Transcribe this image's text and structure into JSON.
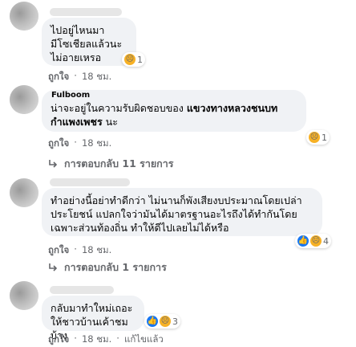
{
  "comments": [
    {
      "text_lines": [
        "ไปอยู่ไหนมา",
        "มีโซเชียลแล้วนะ",
        "ไม่อายเหรอ"
      ],
      "reaction_count": "1",
      "reaction_icons": [
        "sad-icon"
      ],
      "like_label": "ถูกใจ",
      "time": "18 ชม."
    },
    {
      "author": "Fulboom Hippiman",
      "text_prefix": "น่าจะอยู่ในความรับผิดชอบของ ",
      "text_bold": "แขวงทางหลวงชนบทกำแพงเพชร",
      "text_suffix": " นะ",
      "reaction_count": "1",
      "reaction_icons": [
        "sad-icon"
      ],
      "like_label": "ถูกใจ",
      "time": "18 ชม.",
      "replies_label": "การตอบกลับ 11 รายการ"
    },
    {
      "text": "ทำอย่างนี้อย่าทำดีกว่า ไม่นานก็พังเสียงบประมาณโดยเปล่าประโยชน์ แปลกใจว่ามันได้มาตรฐานอะไรถึงได้ทำกันโดยเฉพาะส่วนท้องถิ่น ทำให้ดีไปเลยไม่ได้หรือ",
      "reaction_count": "4",
      "reaction_icons": [
        "like-icon",
        "sad-icon"
      ],
      "like_label": "ถูกใจ",
      "time": "18 ชม.",
      "replies_label": "การตอบกลับ 1 รายการ"
    },
    {
      "text_lines": [
        "กลับมาทำใหม่เถอะ",
        "ให้ชาวบ้านเค้าชมบ้าง"
      ],
      "reaction_count": "3",
      "reaction_icons": [
        "like-icon",
        "sad-icon"
      ],
      "like_label": "ถูกใจ",
      "time": "18 ชม.",
      "reply_label": "แก้ไขแล้ว"
    }
  ],
  "colors": {
    "bubble": "#f0f2f5",
    "meta": "#65676b",
    "like": "#1877f2",
    "sad": "#f7b125"
  }
}
